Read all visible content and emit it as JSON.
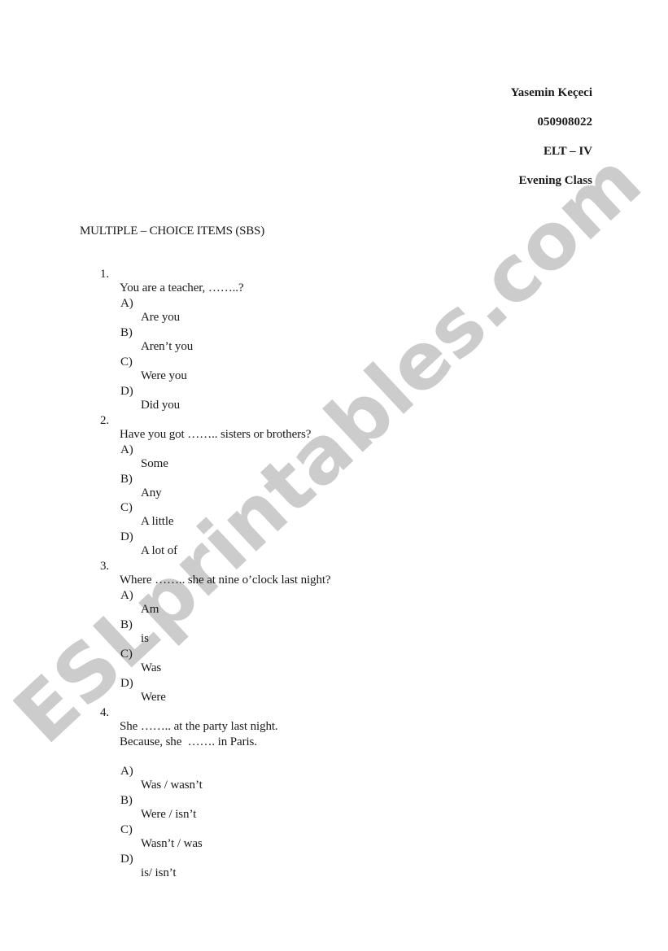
{
  "header": {
    "name": "Yasemin Keçeci",
    "student_number": "050908022",
    "course": "ELT – IV",
    "class": "Evening Class"
  },
  "section_title": "MULTIPLE – CHOICE ITEMS (SBS)",
  "questions": [
    {
      "number": "1.",
      "lines": [
        "You are a teacher, ……..?"
      ],
      "options": [
        {
          "letter": "A)",
          "text": "Are you"
        },
        {
          "letter": "B)",
          "text": "Aren’t you"
        },
        {
          "letter": "C)",
          "text": "Were you"
        },
        {
          "letter": "D)",
          "text": "Did you"
        }
      ]
    },
    {
      "number": "2.",
      "lines": [
        "Have you got …….. sisters or brothers?"
      ],
      "options": [
        {
          "letter": "A)",
          "text": "Some"
        },
        {
          "letter": "B)",
          "text": "Any"
        },
        {
          "letter": "C)",
          "text": "A little"
        },
        {
          "letter": "D)",
          "text": "A lot of"
        }
      ]
    },
    {
      "number": "3.",
      "lines": [
        "Where …….. she at nine o’clock last night?"
      ],
      "options": [
        {
          "letter": "A)",
          "text": "Am"
        },
        {
          "letter": "B)",
          "text": "is"
        },
        {
          "letter": "C)",
          "text": "Was"
        },
        {
          "letter": "D)",
          "text": "Were"
        }
      ]
    },
    {
      "number": "4.",
      "lines": [
        "She …….. at the party last night.",
        "Because, she  ……. in Paris."
      ],
      "options": [
        {
          "letter": "A)",
          "text": "Was / wasn’t"
        },
        {
          "letter": "B)",
          "text": "Were / isn’t"
        },
        {
          "letter": "C)",
          "text": "Wasn’t / was"
        },
        {
          "letter": "D)",
          "text": "is/ isn’t"
        }
      ]
    }
  ],
  "watermark": {
    "text": "ESLprintables.com",
    "color": "#cccccc"
  }
}
